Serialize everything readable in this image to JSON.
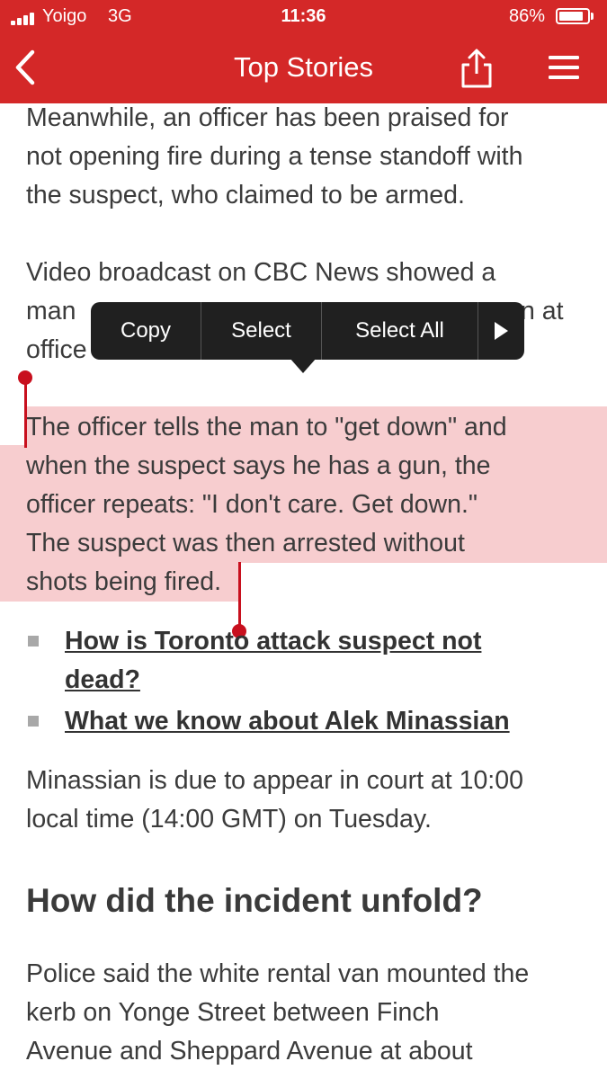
{
  "status_bar": {
    "carrier": "Yoigo",
    "network": "3G",
    "time": "11:36",
    "battery": "86%",
    "battery_level": 0.86
  },
  "nav": {
    "title": "Top Stories",
    "back_icon": "chevron-left-icon",
    "share_icon": "share-icon",
    "menu_icon": "hamburger-menu-icon"
  },
  "article": {
    "paragraph1": [
      "Meanwhile, an officer has been praised for",
      "not opening fire during a tense standoff with",
      "the suspect, who claimed to be armed."
    ],
    "paragraph2": [
      "Video broadcast on CBC News showed a",
      "man",
      "n at",
      "office"
    ],
    "paragraph3": [
      "The officer tells the man to \"get down\" and",
      "when the suspect says he has a gun, the",
      "officer repeats: \"I don't care. Get down.\"",
      "The suspect was then arrested without",
      "shots being fired."
    ],
    "links": [
      {
        "line1": "How is Toronto attack suspect not",
        "line2": "dead?"
      },
      {
        "line1": "What we know about Alek Minassian"
      }
    ],
    "paragraph4": [
      "Minassian is due to appear in court at 10:00",
      "local time (14:00 GMT) on Tuesday."
    ],
    "heading": "How did the incident unfold?",
    "paragraph5": [
      "Police said the white rental van mounted the",
      "kerb on Yonge Street between Finch",
      "Avenue and Sheppard Avenue at about"
    ]
  },
  "context_menu": {
    "copy": "Copy",
    "select": "Select",
    "select_all": "Select All",
    "more_icon": "triangle-right-icon"
  },
  "colors": {
    "brand": "#d42828",
    "selection": "#f4c5c7",
    "handle": "#c8101e",
    "menu_bg": "#202020"
  }
}
